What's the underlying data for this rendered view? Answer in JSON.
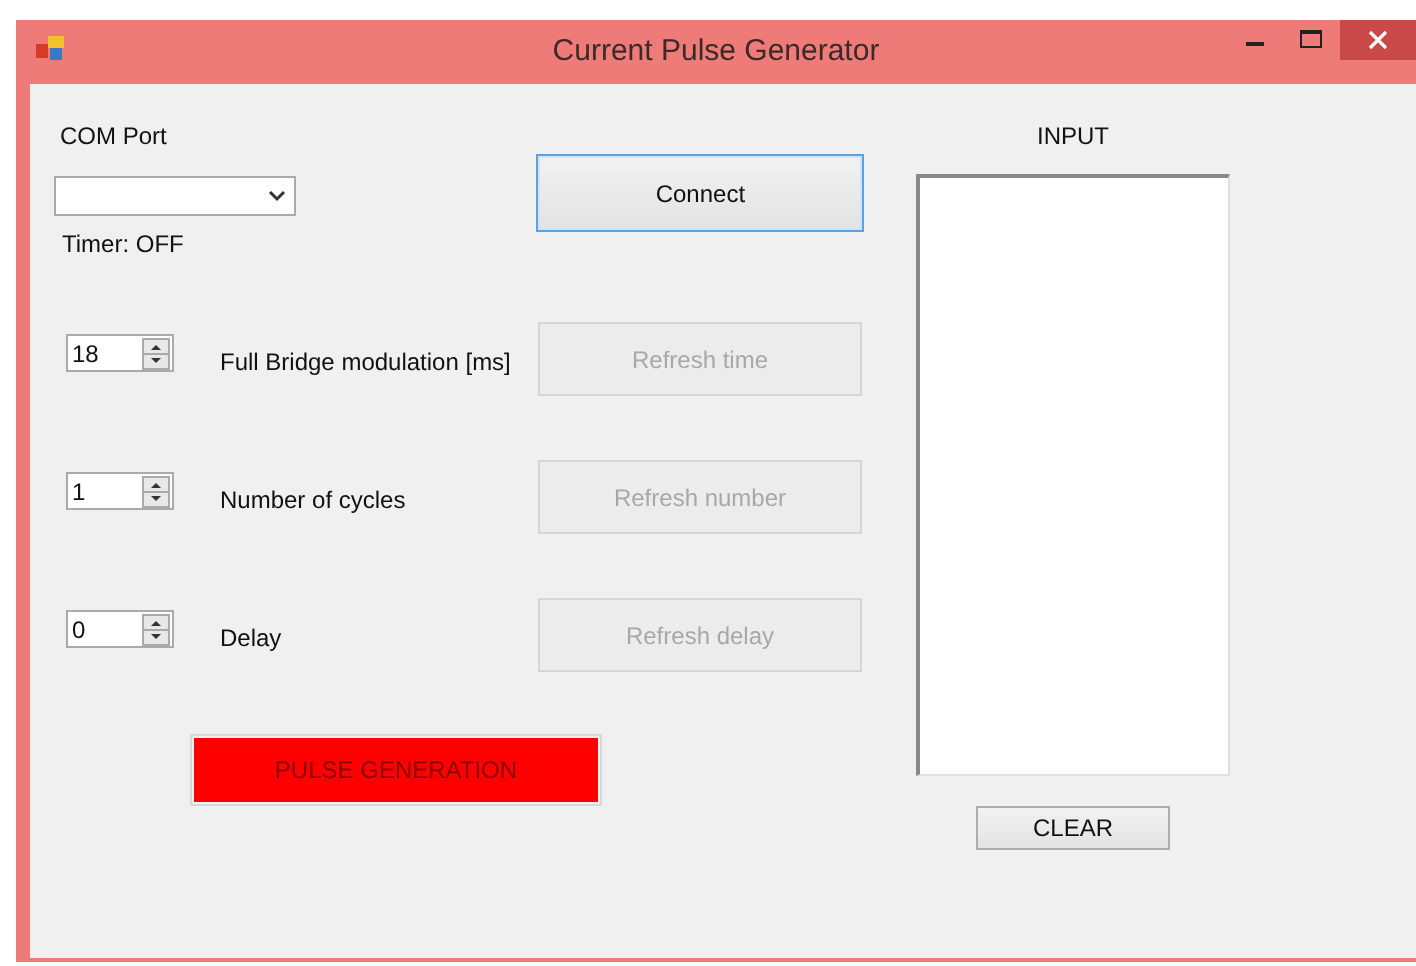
{
  "window": {
    "title": "Current Pulse Generator"
  },
  "com_port": {
    "label": "COM Port",
    "timer": "Timer: OFF"
  },
  "connect": {
    "label": "Connect",
    "focused": true,
    "disabled": false
  },
  "parameters": [
    {
      "value": "18",
      "label": "Full Bridge modulation [ms]",
      "button": {
        "label": "Refresh time",
        "disabled": true
      }
    },
    {
      "value": "1",
      "label": "Number of cycles",
      "button": {
        "label": "Refresh number",
        "disabled": true
      }
    },
    {
      "value": "0",
      "label": "Delay",
      "button": {
        "label": "Refresh delay",
        "disabled": true
      }
    }
  ],
  "pulse": {
    "label": "PULSE GENERATION",
    "color": "#ff0000"
  },
  "input": {
    "label": "INPUT"
  },
  "clear": {
    "label": "CLEAR"
  }
}
